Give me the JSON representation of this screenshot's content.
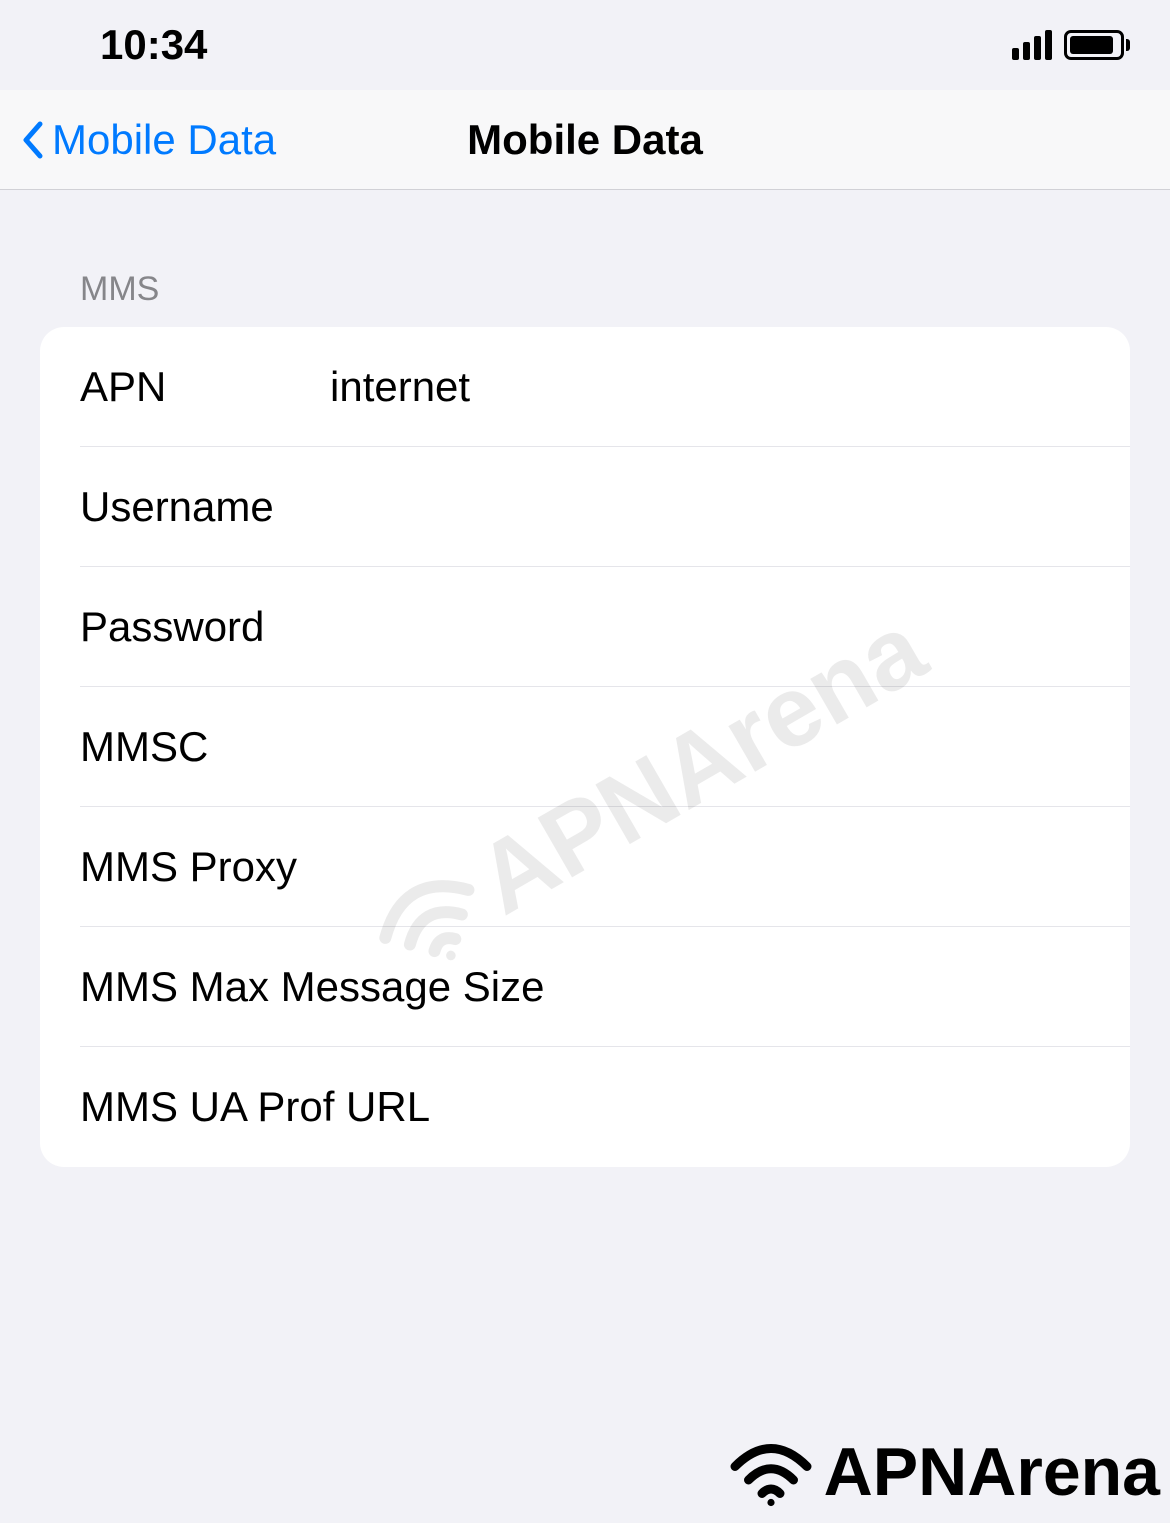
{
  "status_bar": {
    "time": "10:34"
  },
  "nav": {
    "back_label": "Mobile Data",
    "title": "Mobile Data"
  },
  "section": {
    "header": "MMS"
  },
  "fields": {
    "apn": {
      "label": "APN",
      "value": "internet"
    },
    "username": {
      "label": "Username",
      "value": ""
    },
    "password": {
      "label": "Password",
      "value": ""
    },
    "mmsc": {
      "label": "MMSC",
      "value": ""
    },
    "mms_proxy": {
      "label": "MMS Proxy",
      "value": ""
    },
    "mms_max_size": {
      "label": "MMS Max Message Size",
      "value": ""
    },
    "mms_ua_prof": {
      "label": "MMS UA Prof URL",
      "value": ""
    }
  },
  "watermark": {
    "text": "APNArena"
  },
  "footer": {
    "text": "APNArena"
  }
}
